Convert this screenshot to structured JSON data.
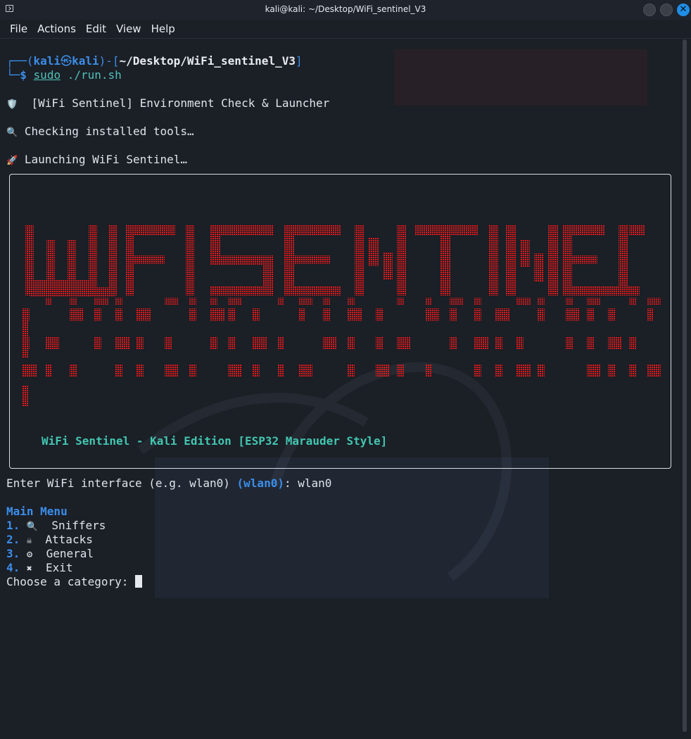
{
  "window": {
    "title": "kali@kali: ~/Desktop/WiFi_sentinel_V3"
  },
  "menu": [
    "File",
    "Actions",
    "Edit",
    "View",
    "Help"
  ],
  "prompt": {
    "user": "kali",
    "host": "kali",
    "path": "~/Desktop/WiFi_sentinel_V3",
    "command": "sudo",
    "args": "./run.sh"
  },
  "output": {
    "env_check": "[WiFi Sentinel] Environment Check & Launcher",
    "checking": "Checking installed tools…",
    "launching": "Launching WiFi Sentinel…"
  },
  "banner": {
    "art_text": "WiFi SENTINEL",
    "subtitle": "WiFi Sentinel - Kali Edition [ESP32 Marauder Style]",
    "color": "#e0191b"
  },
  "interface_prompt": {
    "label": "Enter WiFi interface (e.g. wlan0)",
    "default": "(wlan0)",
    "value": ": wlan0"
  },
  "main_menu": {
    "title": "Main Menu",
    "items": [
      {
        "num": "1.",
        "icon": "🔍",
        "icon_name": "magnifier-icon",
        "label": "Sniffers"
      },
      {
        "num": "2.",
        "icon": "☠",
        "icon_name": "skull-icon",
        "label": "Attacks"
      },
      {
        "num": "3.",
        "icon": "⚙",
        "icon_name": "gear-icon",
        "label": "General"
      },
      {
        "num": "4.",
        "icon": "✖",
        "icon_name": "cross-icon",
        "label": "Exit"
      }
    ],
    "choose_prompt": "Choose a category: "
  },
  "colors": {
    "background": "#1b1f26",
    "accent_blue": "#3b8eea",
    "accent_teal": "#42c6b0",
    "banner_red": "#e0191b"
  }
}
